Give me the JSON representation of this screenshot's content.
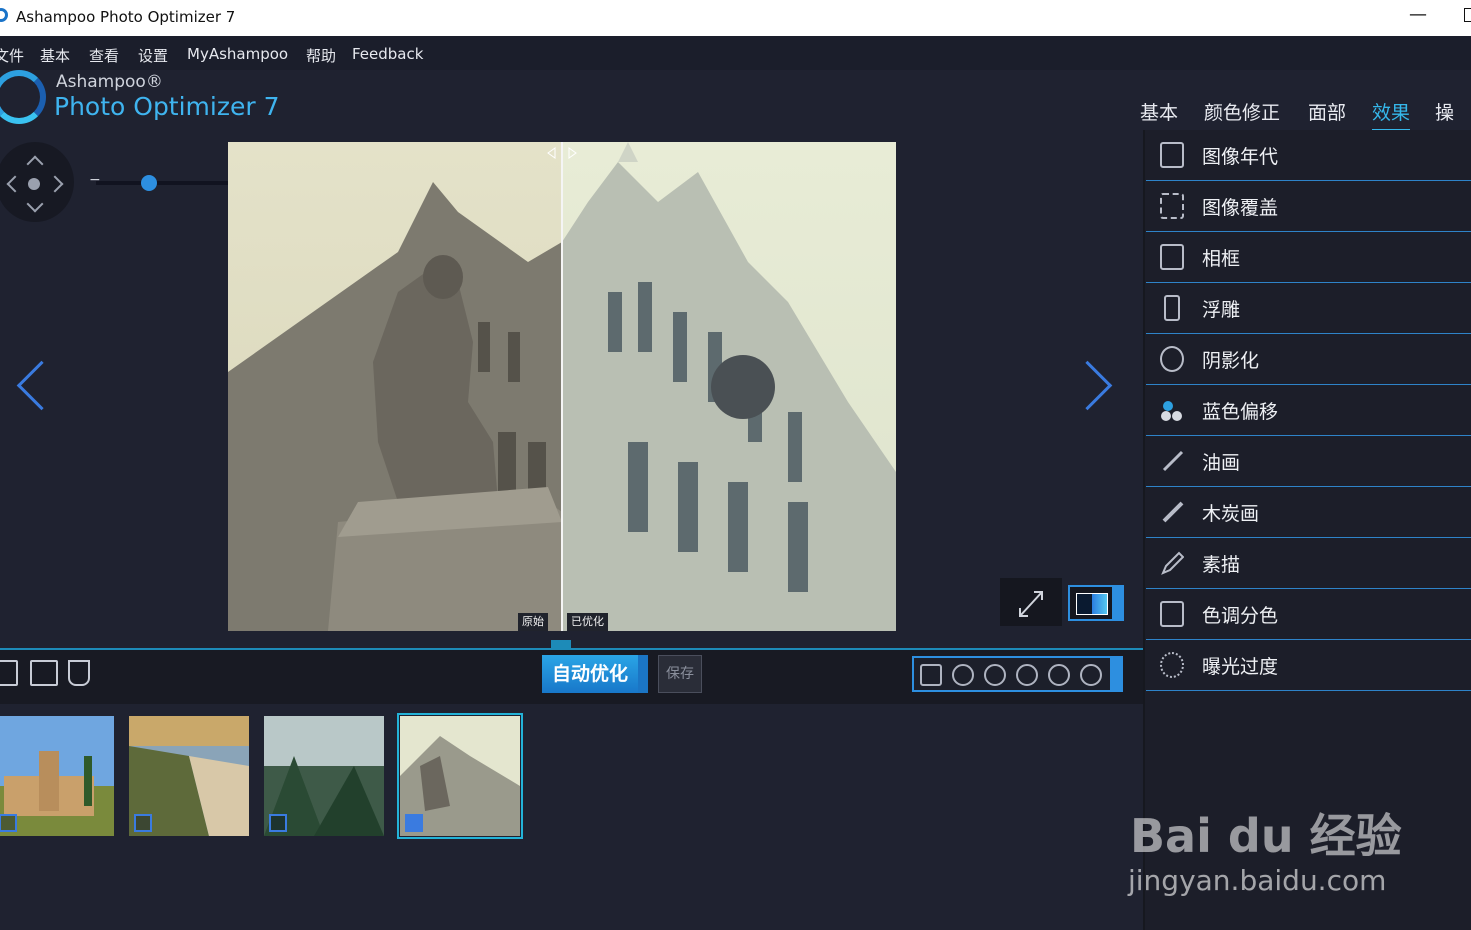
{
  "window": {
    "title": "Ashampoo Photo Optimizer 7",
    "minimize_glyph": "—"
  },
  "menu": [
    "文件",
    "基本",
    "查看",
    "设置",
    "MyAshampoo",
    "帮助",
    "Feedback"
  ],
  "logo": {
    "brand": "Ashampoo®",
    "product": "Photo Optimizer 7"
  },
  "tabs": [
    "基本",
    "颜色修正",
    "面部",
    "效果",
    "操作"
  ],
  "active_tab": "效果",
  "compare": {
    "original_label": "原始",
    "optimized_label": "已优化"
  },
  "zoom": {
    "minus": "−",
    "plus": "+",
    "level": 0.35
  },
  "toolbar": {
    "auto_optimize": "自动优化",
    "save": "保存"
  },
  "effects": [
    "图像年代",
    "图像覆盖",
    "相框",
    "浮雕",
    "阴影化",
    "蓝色偏移",
    "油画",
    "木炭画",
    "素描",
    "色调分色",
    "曝光过度"
  ],
  "effect_icons": [
    "hourglass-icon",
    "image-overlay-icon",
    "frame-icon",
    "emboss-icon",
    "shadow-icon",
    "blue-shift-icon",
    "oil-brush-icon",
    "charcoal-icon",
    "pencil-icon",
    "posterize-icon",
    "overexpose-icon"
  ],
  "thumbnails": [
    {
      "name": "castle",
      "selected": false
    },
    {
      "name": "cliffs",
      "selected": false
    },
    {
      "name": "greenhouse",
      "selected": false
    },
    {
      "name": "cathedral",
      "selected": true
    }
  ],
  "watermark": {
    "brand": "Bai du 经验",
    "url": "jingyan.baidu.com"
  },
  "colors": {
    "accent": "#35b7ea",
    "panel": "#1c1e29",
    "background": "#1f2230"
  }
}
